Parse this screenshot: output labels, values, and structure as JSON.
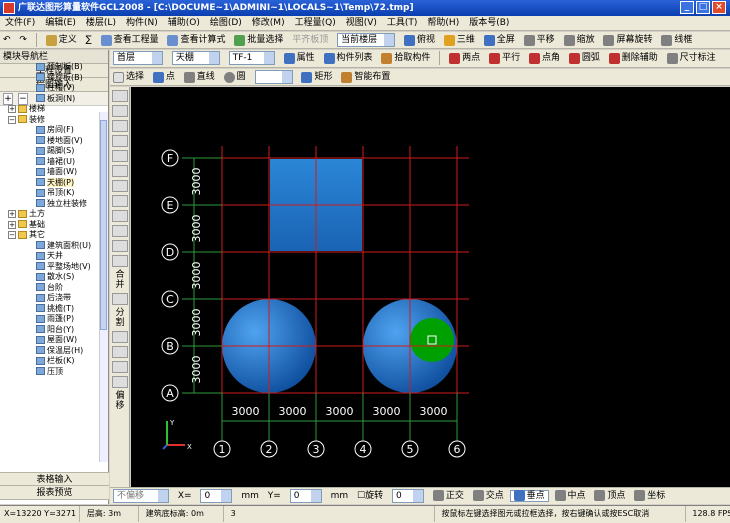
{
  "window": {
    "title": "广联达图形算量软件GCL2008 - [C:\\DOCUME~1\\ADMINI~1\\LOCALS~1\\Temp\\72.tmp]",
    "min": "_",
    "max": "□",
    "close": "×"
  },
  "menu": [
    "文件(F)",
    "编辑(E)",
    "楼层(L)",
    "构件(N)",
    "辅助(O)",
    "绘图(D)",
    "修改(M)",
    "工程量(Q)",
    "视图(V)",
    "工具(T)",
    "帮助(H)",
    "版本号(B)"
  ],
  "toolbar1": {
    "define": "定义",
    "sum": "∑",
    "view_qty": "查看工程量",
    "view_formula": "查看计算式",
    "batch_select": "批量选择",
    "flat_switch": "平齐板顶",
    "current_floor": "当前楼层",
    "view_mode": "俯视",
    "three_d": "三维",
    "fullscreen": "全屏",
    "pan": "平移",
    "zoom": "缩放",
    "screen_rotate": "屏幕旋转",
    "wireframe": "线框"
  },
  "toolbar2": {
    "floor": "首层",
    "category": "天棚",
    "component": "TF-1",
    "property": "属性",
    "component_list": "构件列表",
    "pick": "拾取构件",
    "two_points": "两点",
    "parallel": "平行",
    "point_angle": "点角",
    "circle_aux": "圆弧",
    "delete_aux": "删除辅助",
    "dim_mark": "尺寸标注"
  },
  "toolbar3": {
    "select": "选择",
    "point": "点",
    "line": "直线",
    "arc": "圆",
    "rect": "矩形",
    "smart": "智能布置"
  },
  "panel": {
    "header": "模块导航栏",
    "project_settings": "工程设置",
    "drawing_input": "绘图输入",
    "table_input": "表格输入",
    "report_preview": "报表预览",
    "plus": "+",
    "minus": "−"
  },
  "tree": [
    {
      "label": "预制板(B)",
      "level": 2
    },
    {
      "label": "螺旋板(B)",
      "level": 2
    },
    {
      "label": "柱帽(V)",
      "level": 2
    },
    {
      "label": "板洞(N)",
      "level": 2
    },
    {
      "label": "楼梯",
      "level": 1,
      "exp": "+"
    },
    {
      "label": "装修",
      "level": 1,
      "exp": "−"
    },
    {
      "label": "房间(F)",
      "level": 2
    },
    {
      "label": "楼地面(V)",
      "level": 2
    },
    {
      "label": "踢脚(S)",
      "level": 2
    },
    {
      "label": "墙裙(U)",
      "level": 2
    },
    {
      "label": "墙面(W)",
      "level": 2
    },
    {
      "label": "天棚(P)",
      "level": 2,
      "selected": true
    },
    {
      "label": "吊顶(K)",
      "level": 2
    },
    {
      "label": "独立柱装修",
      "level": 2
    },
    {
      "label": "土方",
      "level": 1,
      "exp": "+"
    },
    {
      "label": "基础",
      "level": 1,
      "exp": "+"
    },
    {
      "label": "其它",
      "level": 1,
      "exp": "−"
    },
    {
      "label": "建筑面积(U)",
      "level": 2
    },
    {
      "label": "天井",
      "level": 2
    },
    {
      "label": "平整场地(V)",
      "level": 2
    },
    {
      "label": "散水(S)",
      "level": 2
    },
    {
      "label": "台阶",
      "level": 2
    },
    {
      "label": "后浇带",
      "level": 2
    },
    {
      "label": "挑檐(T)",
      "level": 2
    },
    {
      "label": "雨篷(P)",
      "level": 2
    },
    {
      "label": "阳台(Y)",
      "level": 2
    },
    {
      "label": "屋面(W)",
      "level": 2
    },
    {
      "label": "保温层(H)",
      "level": 2
    },
    {
      "label": "栏板(K)",
      "level": 2
    },
    {
      "label": "压顶",
      "level": 2
    }
  ],
  "lefttools": [
    "合并",
    "分割",
    "偏移"
  ],
  "grid": {
    "row_labels": [
      "F",
      "E",
      "D",
      "C",
      "B",
      "A"
    ],
    "col_labels": [
      "1",
      "2",
      "3",
      "4",
      "5",
      "6"
    ],
    "spacing_label": "3000",
    "x_spacings": [
      "3000",
      "3000",
      "3000",
      "3000",
      "3000"
    ],
    "y_spacings": [
      "3000",
      "3000",
      "3000",
      "3000",
      "3000"
    ],
    "axis_x": "X",
    "axis_y": "Y"
  },
  "snapbar": {
    "no_offset": "不偏移",
    "x_label": "X=",
    "y_label": "Y=",
    "x_val": "0",
    "y_val": "0",
    "unit": "mm",
    "rotate": "旋转",
    "rotate_val": "0",
    "ortho": "正交",
    "intersect": "交点",
    "vertical": "垂点",
    "midpoint": "中点",
    "vertex": "顶点",
    "coord": "坐标"
  },
  "status": {
    "coords": "X=13220 Y=3271",
    "floor_height": "层高: 3m",
    "elevation": "建筑底标高: 0m",
    "num": "3",
    "hint": "按鼠标左键选择图元或拉框选择，按右键确认或按ESC取消",
    "fps": "128.8 FPS"
  },
  "colors": {
    "grid_red": "#d01c1c",
    "grid_green": "#2e9a38",
    "fill_blue": "#2a7fd4",
    "marker_green": "#00a000"
  }
}
